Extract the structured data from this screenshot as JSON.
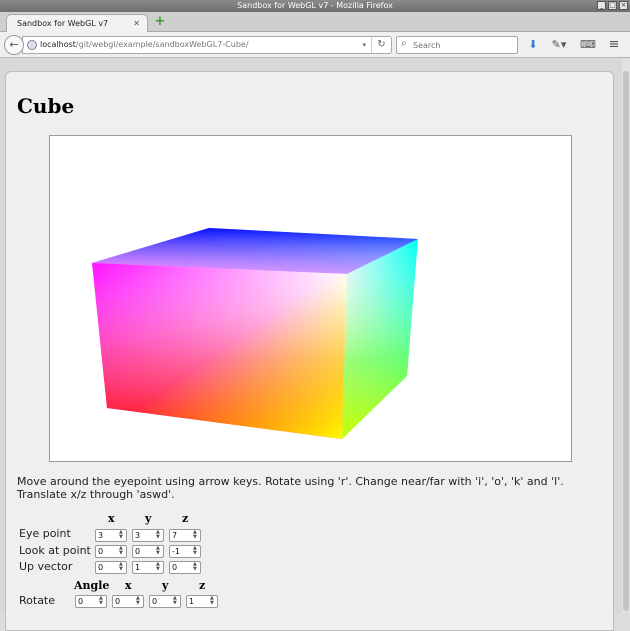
{
  "window": {
    "title": "Sandbox for WebGL v7 - Mozilla Firefox"
  },
  "tabs": [
    {
      "label": "Sandbox for WebGL v7"
    }
  ],
  "navbar": {
    "url_host": "localhost",
    "url_path": "/git/webgl/example/sandboxWebGL7-Cube/",
    "search_placeholder": "Search"
  },
  "page": {
    "heading": "Cube",
    "instructions": "Move around the eyepoint using arrow keys. Rotate using 'r'. Change near/far with 'i', 'o', 'k' and 'l'. Translate x/z through 'aswd'."
  },
  "controls": {
    "headers": {
      "x": "x",
      "y": "y",
      "z": "z"
    },
    "eye_point": {
      "label": "Eye point",
      "x": "3",
      "y": "3",
      "z": "7"
    },
    "look_at": {
      "label": "Look at point",
      "x": "0",
      "y": "0",
      "z": "-1"
    },
    "up_vector": {
      "label": "Up vector",
      "x": "0",
      "y": "1",
      "z": "0"
    },
    "rotate_headers": {
      "angle": "Angle",
      "x": "x",
      "y": "y",
      "z": "z"
    },
    "rotate": {
      "label": "Rotate",
      "angle": "0",
      "x": "0",
      "y": "0",
      "z": "1"
    }
  },
  "colors": {
    "cube_top": [
      "#ff00ff",
      "#0000ff",
      "#00ffff",
      "#ffffff"
    ],
    "cube_front": [
      "#ff00ff",
      "#ffffff",
      "#ffff00",
      "#ff0000"
    ],
    "cube_right": [
      "#ffffff",
      "#00ffff",
      "#00ff00",
      "#ffff00"
    ]
  }
}
